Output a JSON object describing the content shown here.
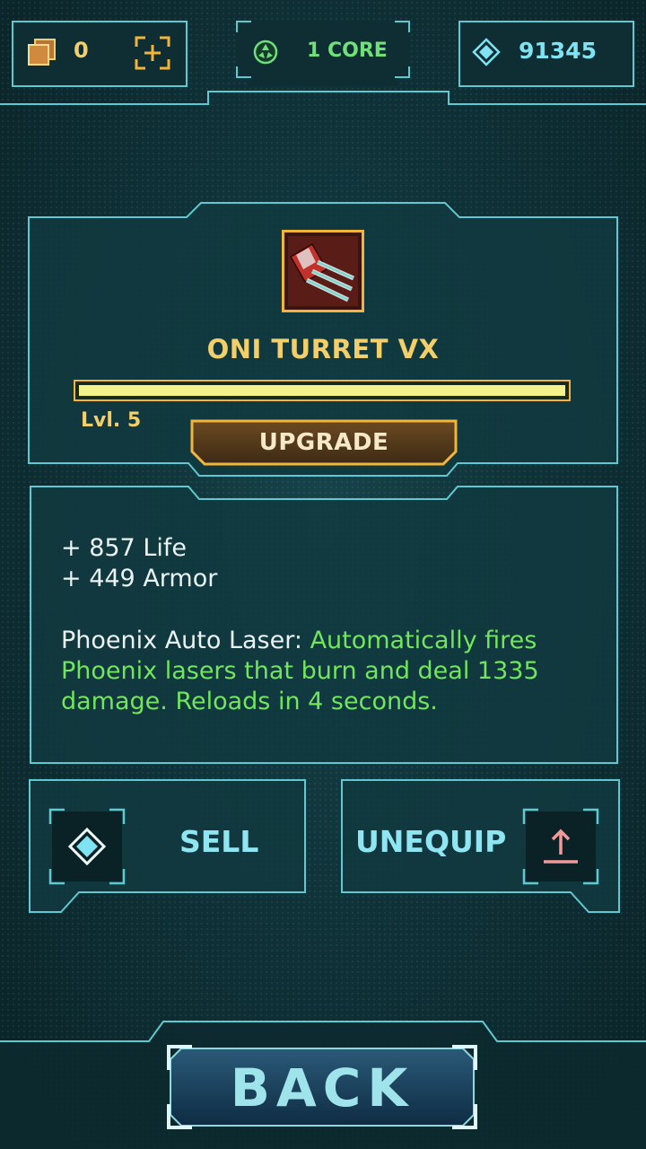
{
  "colors": {
    "frame_cyan": "#5fc8d0",
    "gold": "#f2cf6a",
    "green": "#72e55c",
    "gem_blue": "#7fe3f2",
    "panel_fill": "#123a40"
  },
  "topbar": {
    "cards": {
      "icon": "cards-icon",
      "count": "0",
      "add_icon": "plus-bracket-icon"
    },
    "core": {
      "icon": "core-icon",
      "label": "1 CORE"
    },
    "gems": {
      "icon": "diamond-icon",
      "count": "91345"
    }
  },
  "item": {
    "icon": "turret-item-icon",
    "name": "ONI TURRET VX",
    "level": "Lvl. 5",
    "level_progress": 1.0,
    "upgrade_label": "UPGRADE"
  },
  "stats": {
    "life": "+ 857 Life",
    "armor": "+ 449 Armor",
    "ability_name": "Phoenix Auto Laser:",
    "ability_desc": "Automatically fires Phoenix lasers that burn and deal 1335 damage. Reloads in 4 seconds."
  },
  "actions": {
    "sell_label": "SELL",
    "sell_icon": "diamond-icon",
    "unequip_label": "UNEQUIP",
    "unequip_icon": "unequip-arrow-icon"
  },
  "footer": {
    "back_label": "BACK"
  }
}
